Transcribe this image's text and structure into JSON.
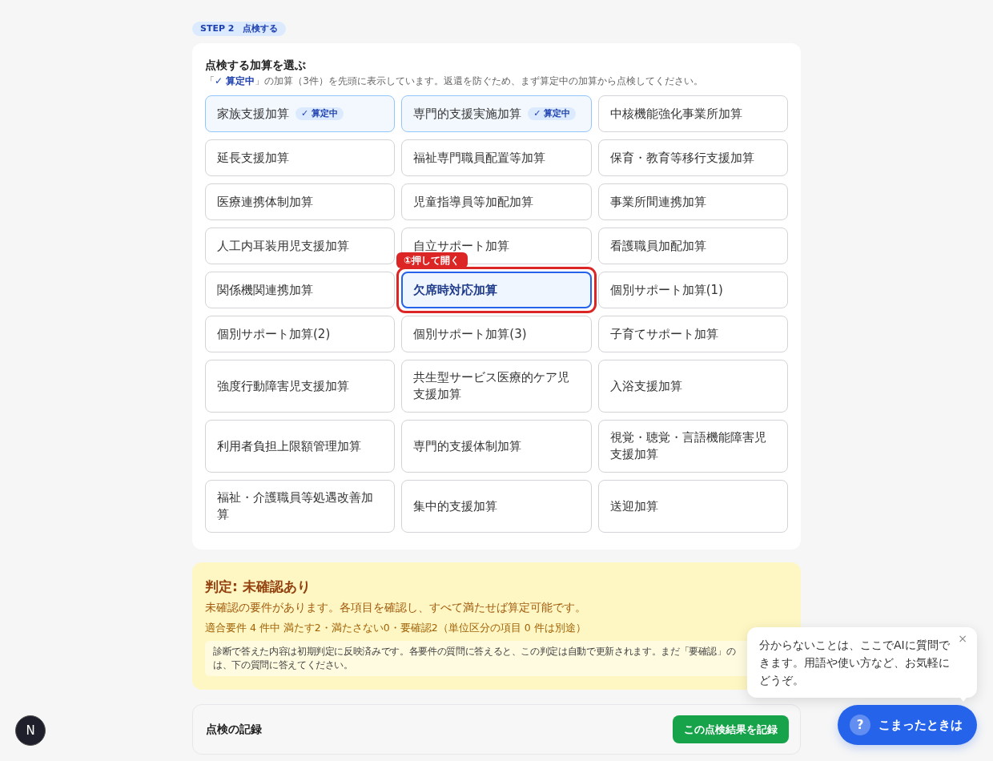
{
  "step_badge": {
    "step": "STEP 2",
    "title": "点検する"
  },
  "selector": {
    "title": "点検する加算を選ぶ",
    "subtitle": "「**✓ 算定中**」の加算（3件）を先頭に表示しています。返還を防ぐため、まず算定中の加算から点検してください。",
    "items": [
      {
        "label": "家族支援加算",
        "calculating": true,
        "badge": "✓ 算定中",
        "highlighted": false
      },
      {
        "label": "専門的支援実施加算",
        "calculating": true,
        "badge": "✓ 算定中",
        "highlighted": false
      },
      {
        "label": "中核機能強化事業所加算",
        "calculating": false,
        "highlighted": false
      },
      {
        "label": "延長支援加算",
        "calculating": false,
        "highlighted": false
      },
      {
        "label": "福祉専門職員配置等加算",
        "calculating": false,
        "highlighted": false
      },
      {
        "label": "保育・教育等移行支援加算",
        "calculating": false,
        "highlighted": false
      },
      {
        "label": "医療連携体制加算",
        "calculating": false,
        "highlighted": false
      },
      {
        "label": "児童指導員等加配加算",
        "calculating": false,
        "highlighted": false
      },
      {
        "label": "事業所間連携加算",
        "calculating": false,
        "highlighted": false
      },
      {
        "label": "人工内耳装用児支援加算",
        "calculating": false,
        "highlighted": false
      },
      {
        "label": "自立サポート加算",
        "calculating": false,
        "highlighted": false
      },
      {
        "label": "看護職員加配加算",
        "calculating": false,
        "highlighted": false
      },
      {
        "label": "関係機関連携加算",
        "calculating": false,
        "highlighted": false
      },
      {
        "label": "欠席時対応加算",
        "calculating": false,
        "highlighted": true,
        "callout": "①押して開く"
      },
      {
        "label": "個別サポート加算(1)",
        "calculating": false,
        "highlighted": false
      },
      {
        "label": "個別サポート加算(2)",
        "calculating": false,
        "highlighted": false
      },
      {
        "label": "個別サポート加算(3)",
        "calculating": false,
        "highlighted": false
      },
      {
        "label": "子育てサポート加算",
        "calculating": false,
        "highlighted": false
      },
      {
        "label": "強度行動障害児支援加算",
        "calculating": false,
        "highlighted": false
      },
      {
        "label": "共生型サービス医療的ケア児支援加算",
        "calculating": false,
        "highlighted": false
      },
      {
        "label": "入浴支援加算",
        "calculating": false,
        "highlighted": false
      },
      {
        "label": "利用者負担上限額管理加算",
        "calculating": false,
        "highlighted": false
      },
      {
        "label": "専門的支援体制加算",
        "calculating": false,
        "highlighted": false
      },
      {
        "label": "視覚・聴覚・言語機能障害児支援加算",
        "calculating": false,
        "highlighted": false
      },
      {
        "label": "福祉・介護職員等処遇改善加算",
        "calculating": false,
        "highlighted": false
      },
      {
        "label": "集中的支援加算",
        "calculating": false,
        "highlighted": false
      },
      {
        "label": "送迎加算",
        "calculating": false,
        "highlighted": false
      }
    ]
  },
  "verdict": {
    "title": "判定: 未確認あり",
    "message": "未確認の要件があります。各項目を確認し、すべて満たせば算定可能です。",
    "stats": "適合要件 4 件中 満たす2・満たさない0・要確認2（単位区分の項目 0 件は別途）",
    "note_lines": [
      "診断で答えた内容は初期判定に反映済みです。各要件の質問に答えると、この判定は自動で更新されます。まだ「要確認」の",
      "は、下の質問に答えてください。"
    ]
  },
  "record": {
    "title": "点検の記録",
    "button": "この点検結果を記録"
  },
  "help": {
    "popover_text": "分からないことは、ここでAIに質問できます。用語や使い方など、お気軽にどうぞ。",
    "close": "×",
    "button_icon": "?",
    "button_label": "こまったときは"
  },
  "dev_badge": {
    "label": "N"
  }
}
